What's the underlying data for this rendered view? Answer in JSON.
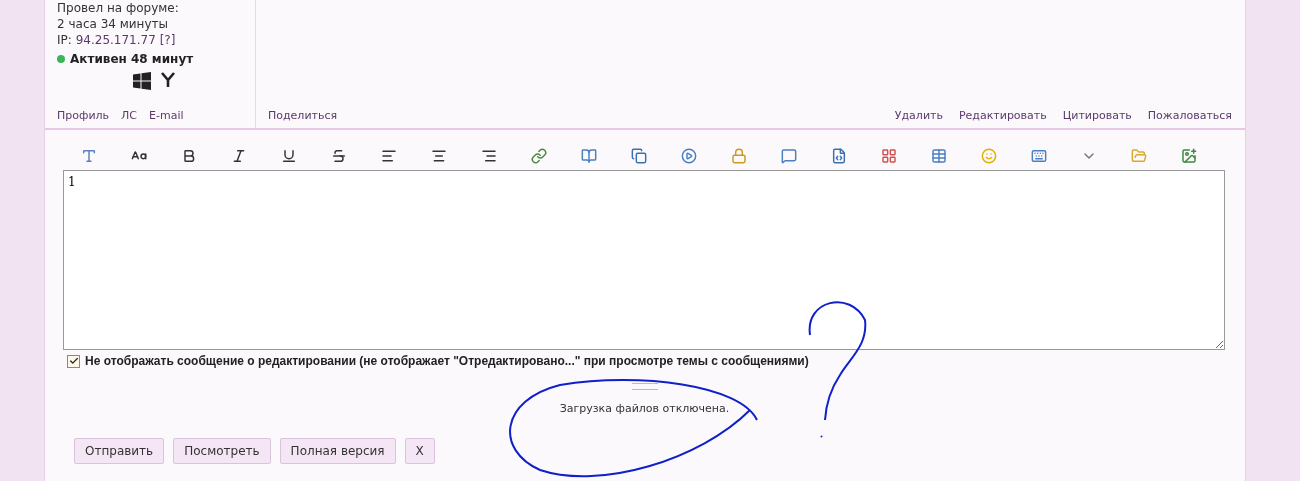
{
  "post": {
    "author_lines": [
      "Провел на форуме:",
      "2 часа 34 минуты"
    ],
    "ip": {
      "label": "IP:",
      "address": "94.25.171.77",
      "help": "[?]"
    },
    "activity": {
      "text": "Активен 48 минут",
      "online": true
    },
    "profile_links": [
      "Профиль",
      "ЛС",
      "E-mail"
    ],
    "share_link": "Поделиться",
    "actions": [
      "Удалить",
      "Редактировать",
      "Цитировать",
      "Пожаловаться"
    ]
  },
  "editor": {
    "value": "1",
    "hide_edit_notice": {
      "label": "Не отображать сообщение о редактировании (не отображает \"Отредактировано...\" при просмотре темы с сообщениями)",
      "checked": true
    },
    "upload_note": "Загрузка файлов отключена.",
    "buttons": [
      "Отправить",
      "Посмотреть",
      "Полная версия",
      "X"
    ]
  }
}
